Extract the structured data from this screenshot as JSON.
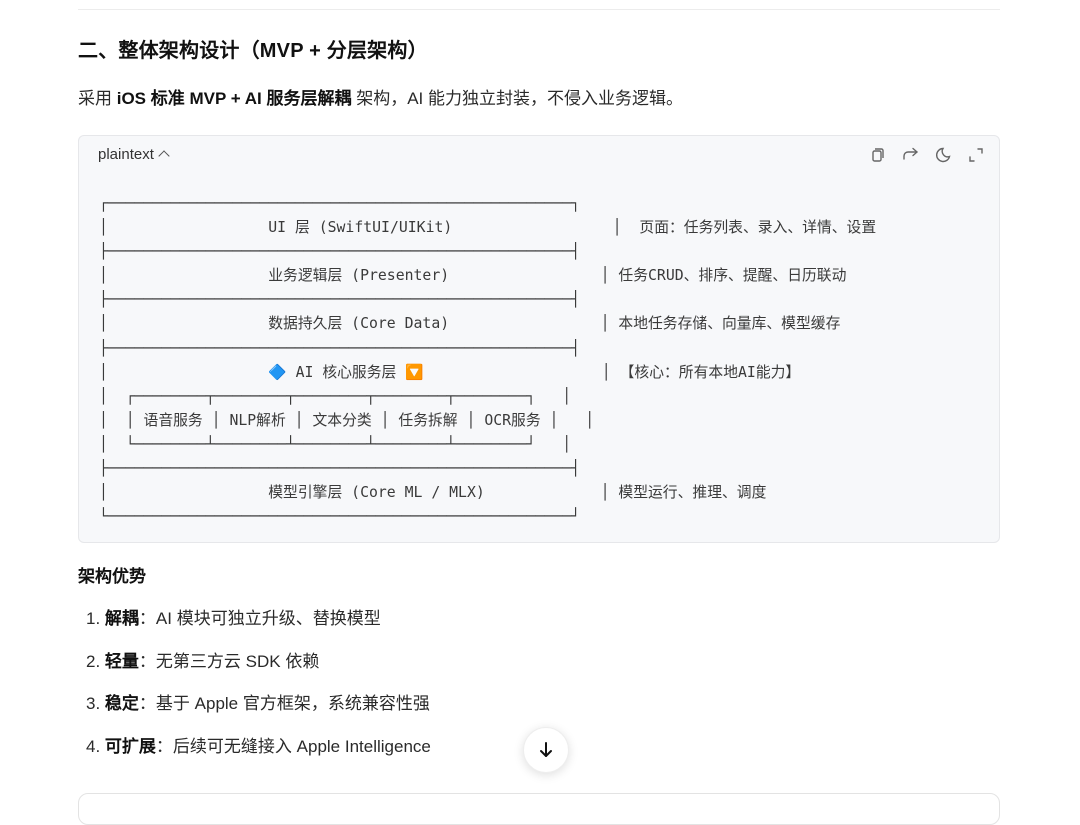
{
  "section": {
    "heading": "二、整体架构设计（MVP + 分层架构）",
    "intro": {
      "prefix": "采用 ",
      "bold": "iOS 标准 MVP + AI 服务层解耦",
      "suffix": " 架构，AI 能力独立封装，不侵入业务逻辑。"
    }
  },
  "code_block": {
    "language": "plaintext",
    "toolbar": [
      "copy-icon",
      "share-icon",
      "theme-icon",
      "expand-icon"
    ],
    "lines": [
      "┌────────────────────────────────────────────────────┐",
      "│                  UI 层 (SwiftUI/UIKit)                  │  页面：任务列表、录入、详情、设置",
      "├────────────────────────────────────────────────────┤",
      "│                  业务逻辑层 (Presenter)                 │ 任务CRUD、排序、提醒、日历联动",
      "├────────────────────────────────────────────────────┤",
      "│                  数据持久层 (Core Data)                 │ 本地任务存储、向量库、模型缓存",
      "├────────────────────────────────────────────────────┤",
      "│                  🔷 AI 核心服务层 🔽                    │ 【核心：所有本地AI能力】",
      "│  ┌────────┬────────┬────────┬────────┬────────┐   │",
      "│  │ 语音服务 │ NLP解析 │ 文本分类 │ 任务拆解 │ OCR服务 │   │",
      "│  └────────┴────────┴────────┴────────┴────────┘   │",
      "├────────────────────────────────────────────────────┤",
      "│                  模型引擎层 (Core ML / MLX)             │ 模型运行、推理、调度",
      "└────────────────────────────────────────────────────┘"
    ]
  },
  "advantages": {
    "title": "架构优势",
    "items": [
      {
        "num": "1.",
        "bold": "解耦",
        "text": "：AI 模块可独立升级、替换模型"
      },
      {
        "num": "2.",
        "bold": "轻量",
        "text": "：无第三方云 SDK 依赖"
      },
      {
        "num": "3.",
        "bold": "稳定",
        "text": "：基于 Apple 官方框架，系统兼容性强"
      },
      {
        "num": "4.",
        "bold": "可扩展",
        "text": "：后续可无缝接入 Apple Intelligence"
      }
    ]
  },
  "scroll_button": {
    "icon": "arrow-down-icon"
  }
}
